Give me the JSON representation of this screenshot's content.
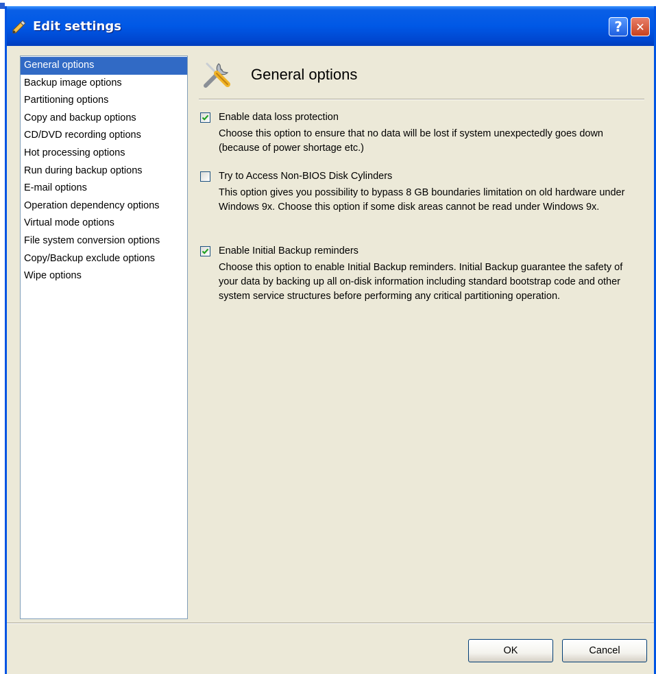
{
  "window": {
    "title": "Edit settings",
    "help_label": "?",
    "close_label": "✕"
  },
  "sidebar": {
    "items": [
      {
        "label": "General options",
        "selected": true
      },
      {
        "label": "Backup image options",
        "selected": false
      },
      {
        "label": "Partitioning options",
        "selected": false
      },
      {
        "label": "Copy and backup options",
        "selected": false
      },
      {
        "label": "CD/DVD recording options",
        "selected": false
      },
      {
        "label": "Hot processing options",
        "selected": false
      },
      {
        "label": "Run during backup options",
        "selected": false
      },
      {
        "label": "E-mail options",
        "selected": false
      },
      {
        "label": "Operation dependency options",
        "selected": false
      },
      {
        "label": "Virtual mode options",
        "selected": false
      },
      {
        "label": "File system conversion options",
        "selected": false
      },
      {
        "label": "Copy/Backup exclude options",
        "selected": false
      },
      {
        "label": "Wipe options",
        "selected": false
      }
    ]
  },
  "main": {
    "title": "General options",
    "options": [
      {
        "label": "Enable data loss protection",
        "checked": true,
        "description": "Choose this option to ensure that no data will be lost if system unexpectedly goes down (because of power shortage etc.)"
      },
      {
        "label": "Try to Access Non-BIOS Disk Cylinders",
        "checked": false,
        "description": "This option gives you possibility to bypass 8 GB boundaries limitation on old hardware under Windows 9x. Choose this option if some disk areas cannot be read under Windows 9x."
      },
      {
        "label": "Enable Initial Backup reminders",
        "checked": true,
        "description": "Choose this option to enable Initial Backup reminders. Initial Backup guarantee the safety of your data by backing up all on-disk information including standard bootstrap code and other system service structures before performing any critical partitioning operation."
      }
    ]
  },
  "footer": {
    "ok_label": "OK",
    "cancel_label": "Cancel"
  },
  "colors": {
    "titlebar": "#0058e6",
    "selection": "#316ac5",
    "dialog_bg": "#ece9d8",
    "check": "#21a121"
  }
}
